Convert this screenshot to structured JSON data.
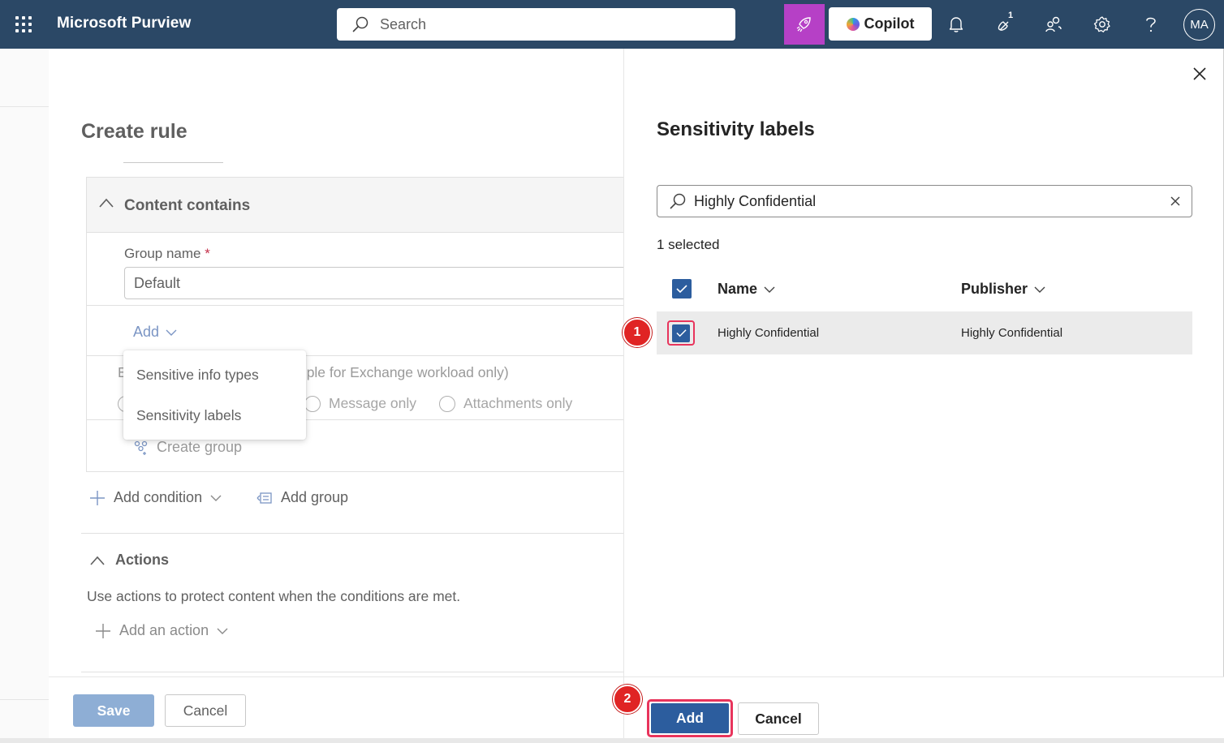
{
  "topbar": {
    "app_title": "Microsoft Purview",
    "search_placeholder": "Search",
    "copilot_label": "Copilot",
    "notification_count": "1",
    "avatar_initials": "MA"
  },
  "page": {
    "title": "Create rule",
    "content_contains": {
      "title": "Content contains",
      "group_name_label": "Group name",
      "required_mark": "*",
      "group_name_value": "Default",
      "add_label": "Add",
      "exchange_text": "ple for Exchange workload only)",
      "exchange_prefix": "E",
      "radio_options": [
        "Message only",
        "Attachments only"
      ],
      "create_group_label": "Create group"
    },
    "add_menu": {
      "items": [
        "Sensitive info types",
        "Sensitivity labels"
      ]
    },
    "add_condition_label": "Add condition",
    "add_group_label": "Add group",
    "actions": {
      "title": "Actions",
      "description": "Use actions to protect content when the conditions are met.",
      "add_action_label": "Add an action"
    },
    "footer": {
      "save_label": "Save",
      "cancel_label": "Cancel"
    }
  },
  "panel": {
    "title": "Sensitivity labels",
    "search_value": "Highly Confidential",
    "selected_count": "1 selected",
    "columns": [
      "Name",
      "Publisher"
    ],
    "rows": [
      {
        "name": "Highly Confidential",
        "publisher": "Highly Confidential",
        "selected": true
      }
    ],
    "footer": {
      "add_label": "Add",
      "cancel_label": "Cancel"
    }
  },
  "annotations": {
    "step1": "1",
    "step2": "2"
  },
  "colors": {
    "topbar": "#2b4866",
    "accent": "#2c5d9e",
    "rocket": "#b640c6",
    "highlight": "#e8345c",
    "badge": "#e02424"
  }
}
